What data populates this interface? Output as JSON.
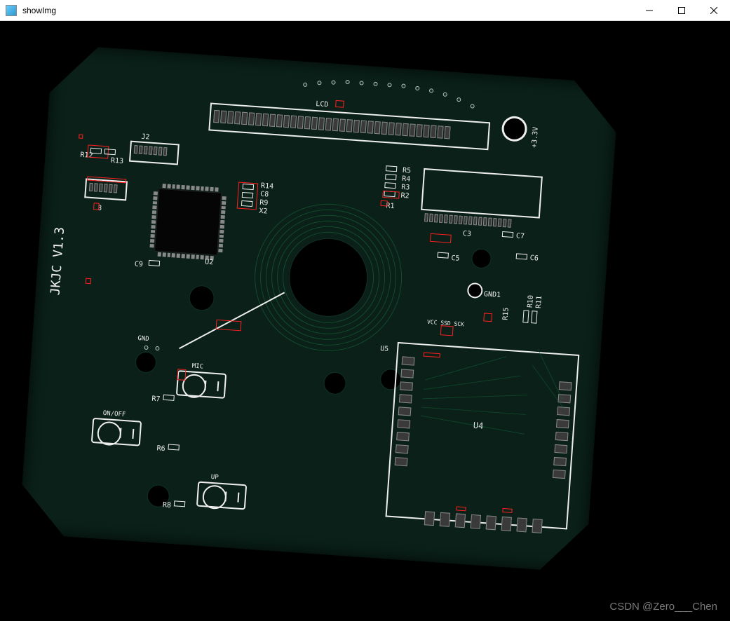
{
  "window": {
    "title": "showImg"
  },
  "watermark": "CSDN @Zero___Chen",
  "pcb": {
    "version_label": "JKJC  V1.3",
    "lcd_label": "LCD",
    "voltage_label": "+3.3V",
    "gnd1_label": "GND1",
    "gnd_label": "GND",
    "u2_label": "U2",
    "u4_label": "U4",
    "u5_label": "U5",
    "j2_label": "J2",
    "mic_label": "MIC",
    "onoff_label": "ON/OFF",
    "up_label": "UP",
    "vcc_label": "VCC SSD SCK",
    "r1_label": "R1",
    "r2_label": "R2",
    "r3_label": "R3",
    "r4_label": "R4",
    "r5_label": "R5",
    "r6_label": "R6",
    "r7_label": "R7",
    "r8_label": "R8",
    "r9_label": "R9",
    "r10_label": "R10",
    "r11_label": "R11",
    "r12_label": "R12",
    "r13_label": "R13",
    "r14_label": "R14",
    "r15_label": "R15",
    "c3_label": "C3",
    "c5_label": "C5",
    "c6_label": "C6",
    "c7_label": "C7",
    "c8_label": "C8",
    "c9_label": "C9",
    "x2_label": "X2",
    "three_label": "3"
  }
}
